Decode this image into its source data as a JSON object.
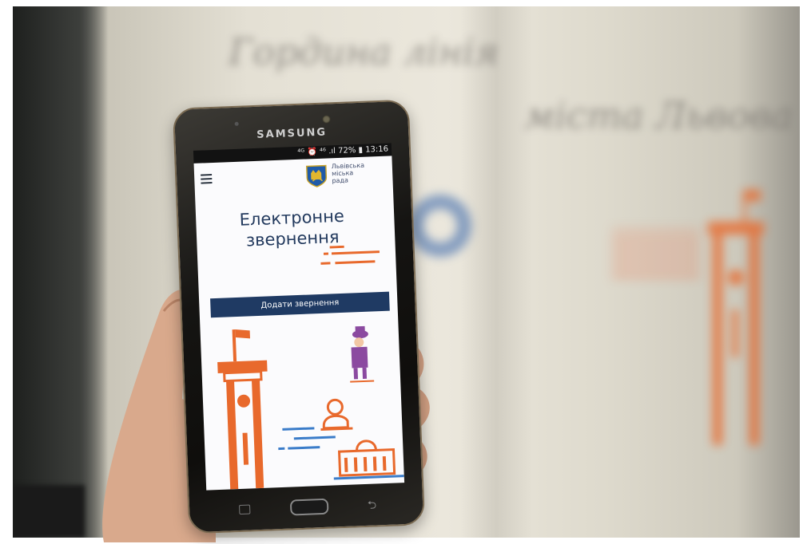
{
  "background": {
    "blurred_wall_text_line1": "Гордина лінія",
    "blurred_wall_text_line2": "міста Львова"
  },
  "phone": {
    "brand": "SAMSUNG",
    "status_bar": "⁴ᴳ ⏰ ⁴⁶ .ıl 72% ▮ 13:16"
  },
  "app": {
    "logo_text_line1": "Львівська",
    "logo_text_line2": "міська",
    "logo_text_line3": "рада",
    "title_line1": "Електронне",
    "title_line2": "звернення",
    "add_button_label": "Додати звернення"
  },
  "colors": {
    "accent_navy": "#1f3a63",
    "title_blue": "#233a5e",
    "illustration_orange": "#e8692c",
    "illustration_blue": "#3a7cc9",
    "illustration_purple": "#8b4aa0"
  }
}
